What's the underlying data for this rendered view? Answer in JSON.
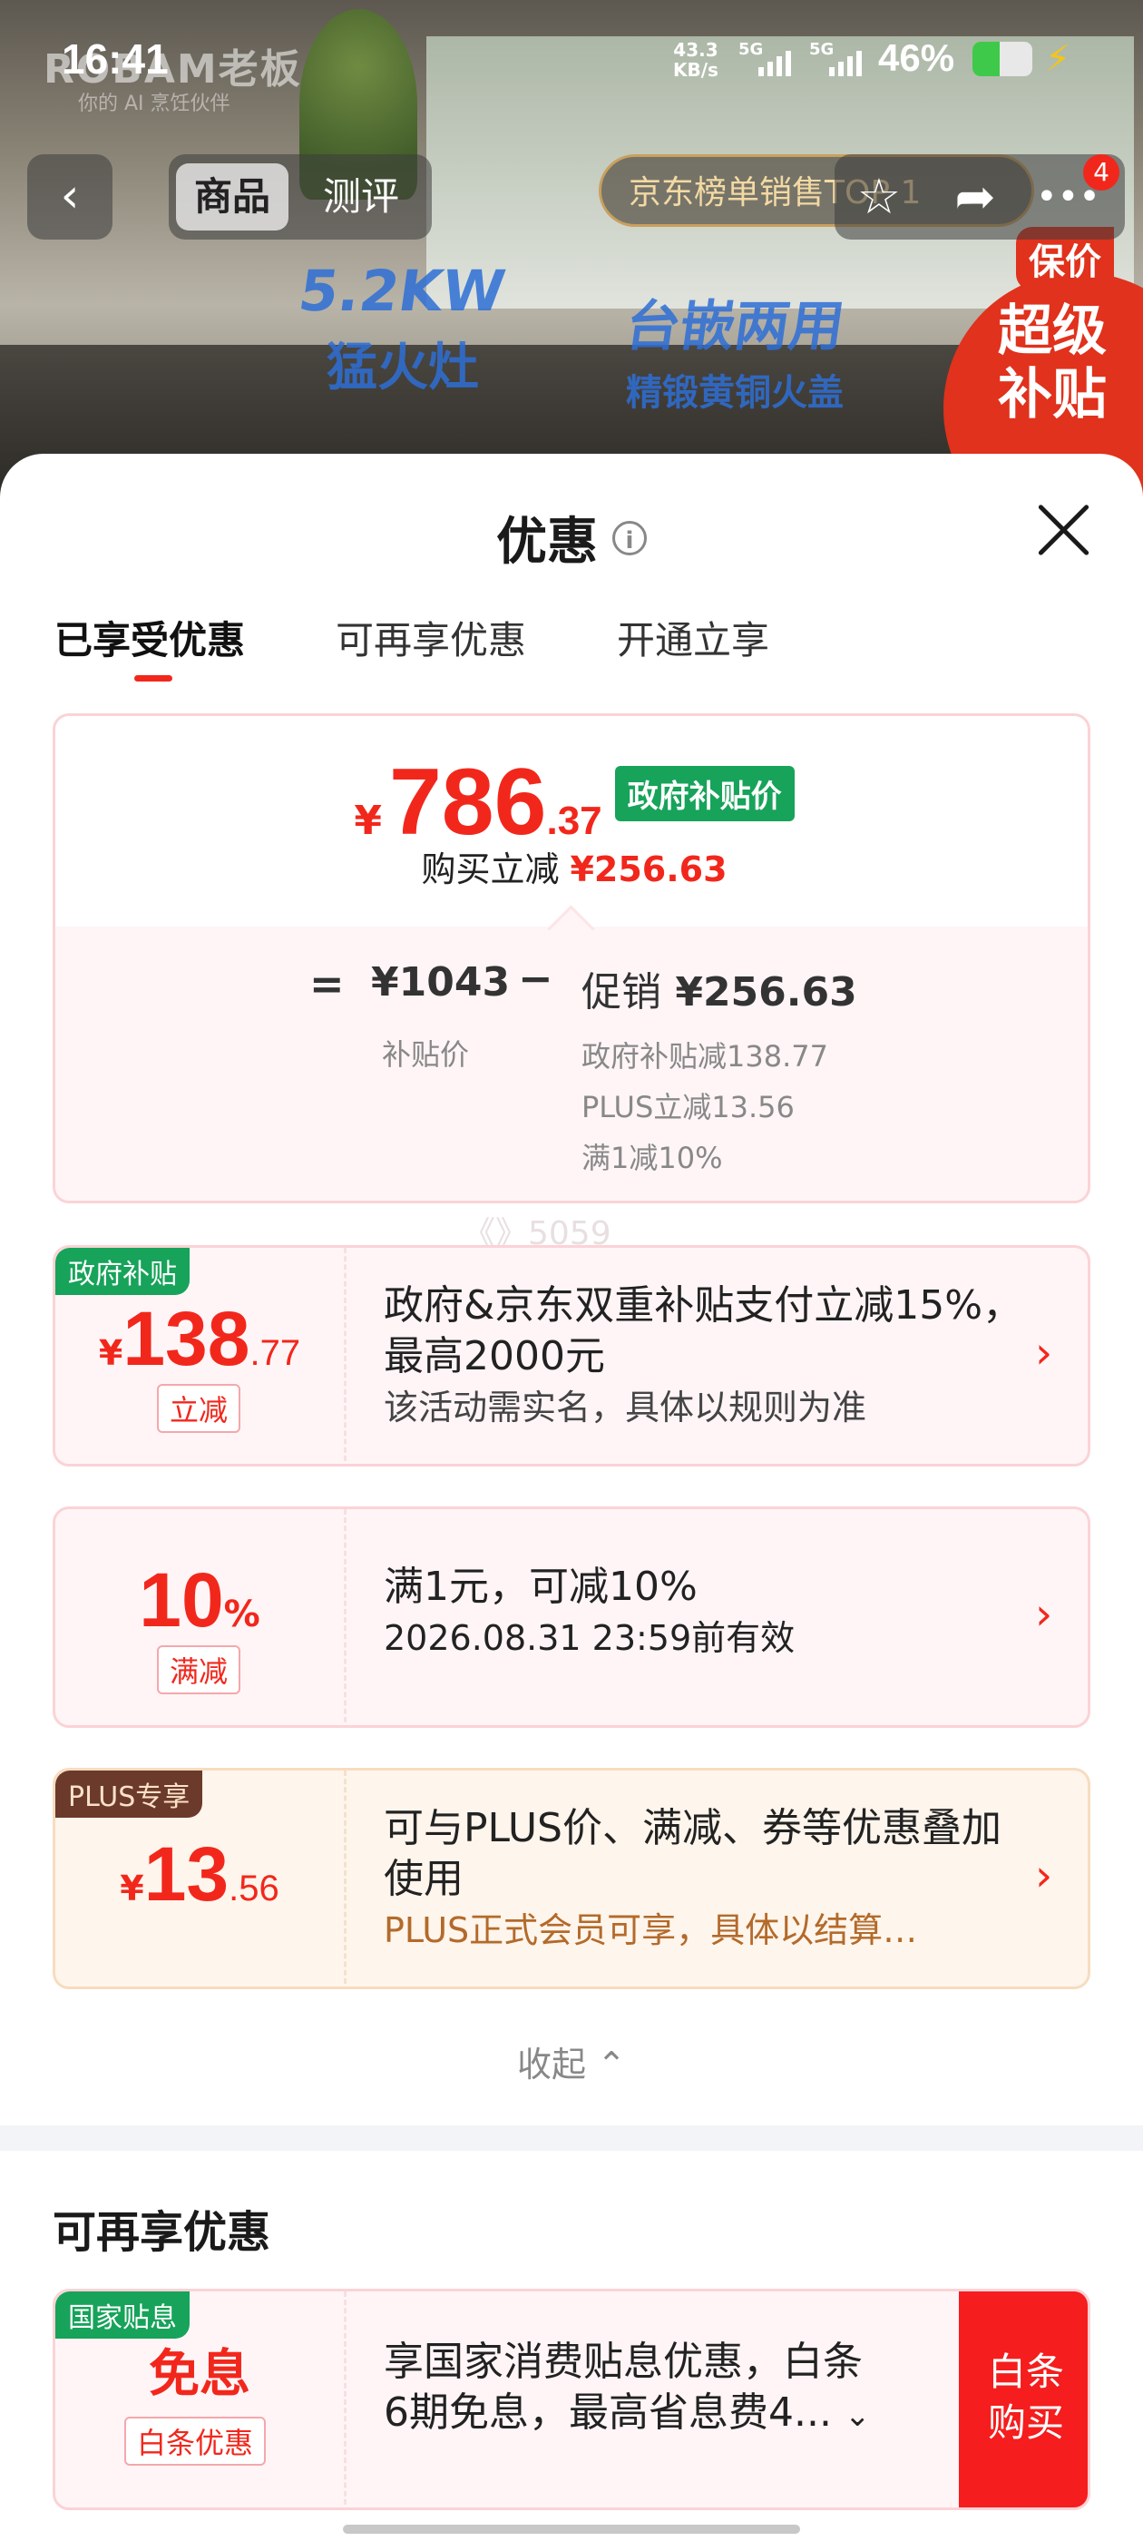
{
  "status_bar": {
    "time": "16:41",
    "net_speed_value": "43.3",
    "net_speed_unit": "KB/s",
    "sim1": "5G",
    "sim2": "5G",
    "battery": "46%",
    "battery_level": 0.46
  },
  "background": {
    "brand": "ROBAM老板",
    "brand_sub": "你的 AI 烹饪伙伴",
    "headline1": "5.2KW",
    "headline2": "猛火灶",
    "headline3": "台嵌两用",
    "headline4": "精锻黄铜火盖",
    "badge_top": "保价",
    "badge_main": "超级补贴"
  },
  "nav": {
    "back_icon": "chevron-left-icon",
    "tab_product": "商品",
    "tab_review": "测评",
    "rank_text": "京东榜单销售TOP 1",
    "cart_badge": "4"
  },
  "sheet": {
    "title": "优惠",
    "tabs": [
      "已享受优惠",
      "可再享优惠",
      "开通立享"
    ],
    "summary": {
      "currency": "¥",
      "price_int": "786",
      "price_dec": ".37",
      "price_tag": "政府补贴价",
      "reduce_label": "购买立减",
      "reduce_value": "¥256.63",
      "eq": "=",
      "base_price": "¥1043",
      "minus": "−",
      "promo_label": "促销",
      "promo_value": "¥256.63",
      "base_label": "补贴价",
      "details": [
        "政府补贴减138.77",
        "PLUS立减13.56",
        "满1减10%"
      ]
    },
    "watermark": "《》5059",
    "coupons": [
      {
        "tag": "政府补贴",
        "yen": "¥",
        "int": "138",
        "dec": ".77",
        "chip": "立减",
        "desc": "政府&京东双重补贴支付立减15%，最高2000元",
        "sub": "该活动需实名，具体以规则为准"
      },
      {
        "int": "10",
        "pct": "%",
        "chip": "满减",
        "desc": "满1元，可减10%",
        "sub": "2026.08.31 23:59前有效"
      },
      {
        "tag": "PLUS专享",
        "yen": "¥",
        "int": "13",
        "dec": ".56",
        "desc": "可与PLUS价、满减、券等优惠叠加使用",
        "sub": "PLUS正式会员可享，具体以结算…"
      }
    ],
    "collapse_label": "收起",
    "more_title": "可再享优惠",
    "more_card": {
      "tag": "国家贴息",
      "title": "免息",
      "chip": "白条优惠",
      "desc_line1": "享国家消费贴息优惠，白条",
      "desc_line2": "6期免息，最高省息费4...",
      "cta": "白条购买"
    }
  }
}
